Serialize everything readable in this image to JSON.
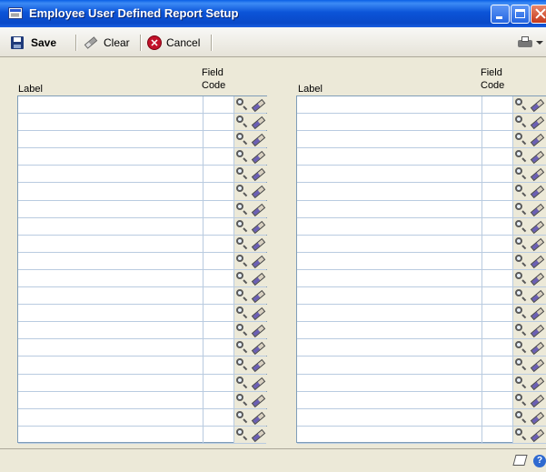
{
  "window": {
    "title": "Employee User Defined Report Setup"
  },
  "toolbar": {
    "save_label": "Save",
    "clear_label": "Clear",
    "cancel_label": "Cancel"
  },
  "columns": {
    "label": "Label",
    "field_code_line1": "Field",
    "field_code_line2": "Code"
  },
  "grid": {
    "row_count": 20,
    "left_rows": [
      {
        "label": "",
        "code": ""
      },
      {
        "label": "",
        "code": ""
      },
      {
        "label": "",
        "code": ""
      },
      {
        "label": "",
        "code": ""
      },
      {
        "label": "",
        "code": ""
      },
      {
        "label": "",
        "code": ""
      },
      {
        "label": "",
        "code": ""
      },
      {
        "label": "",
        "code": ""
      },
      {
        "label": "",
        "code": ""
      },
      {
        "label": "",
        "code": ""
      },
      {
        "label": "",
        "code": ""
      },
      {
        "label": "",
        "code": ""
      },
      {
        "label": "",
        "code": ""
      },
      {
        "label": "",
        "code": ""
      },
      {
        "label": "",
        "code": ""
      },
      {
        "label": "",
        "code": ""
      },
      {
        "label": "",
        "code": ""
      },
      {
        "label": "",
        "code": ""
      },
      {
        "label": "",
        "code": ""
      },
      {
        "label": "",
        "code": ""
      }
    ],
    "right_rows": [
      {
        "label": "",
        "code": ""
      },
      {
        "label": "",
        "code": ""
      },
      {
        "label": "",
        "code": ""
      },
      {
        "label": "",
        "code": ""
      },
      {
        "label": "",
        "code": ""
      },
      {
        "label": "",
        "code": ""
      },
      {
        "label": "",
        "code": ""
      },
      {
        "label": "",
        "code": ""
      },
      {
        "label": "",
        "code": ""
      },
      {
        "label": "",
        "code": ""
      },
      {
        "label": "",
        "code": ""
      },
      {
        "label": "",
        "code": ""
      },
      {
        "label": "",
        "code": ""
      },
      {
        "label": "",
        "code": ""
      },
      {
        "label": "",
        "code": ""
      },
      {
        "label": "",
        "code": ""
      },
      {
        "label": "",
        "code": ""
      },
      {
        "label": "",
        "code": ""
      },
      {
        "label": "",
        "code": ""
      },
      {
        "label": "",
        "code": ""
      }
    ]
  },
  "icons": {
    "title": "window-app-icon",
    "save": "floppy-disk-icon",
    "clear": "eraser-icon",
    "cancel": "cancel-x-icon",
    "print": "printer-icon",
    "lookup": "magnifier-lookup-icon",
    "erase": "eraser-icon",
    "note": "note-icon",
    "help": "help-icon"
  },
  "colors": {
    "titlebar": "#0a54d8",
    "face": "#ece9d8",
    "grid_border": "#7f9db9",
    "cancel_red": "#c2122a"
  }
}
